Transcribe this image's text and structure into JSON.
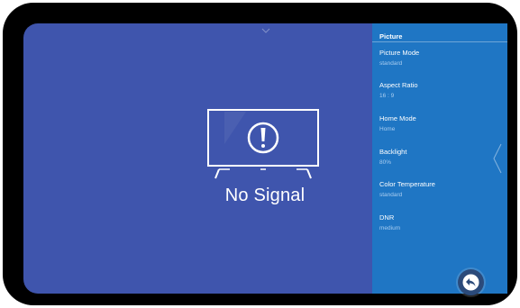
{
  "screen": {
    "message": "No Signal",
    "icons": {
      "tv": "tv-no-signal-icon",
      "alert": "exclamation-icon",
      "collapse": "chevron-down-icon",
      "side": "chevron-left-icon",
      "back": "back-arrow-icon"
    }
  },
  "panel": {
    "title": "Picture",
    "items": [
      {
        "label": "Picture Mode",
        "value": "standard"
      },
      {
        "label": "Aspect Ratio",
        "value": "16 : 9"
      },
      {
        "label": "Home Mode",
        "value": "Home"
      },
      {
        "label": "Backlight",
        "value": "80%"
      },
      {
        "label": "Color Temperature",
        "value": "standard"
      },
      {
        "label": "DNR",
        "value": "medium"
      }
    ]
  },
  "colors": {
    "screen_bg": "#3f55ad",
    "panel_bg": "#1f76c4",
    "value_text": "#a9cdf0",
    "back_button": "#2b4a7a"
  }
}
